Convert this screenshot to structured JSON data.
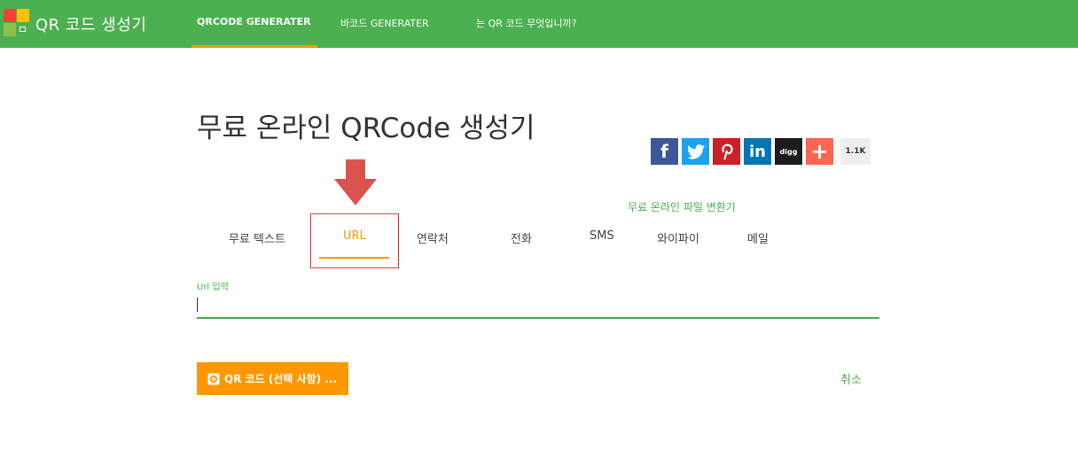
{
  "header": {
    "brand": "QR 코드 생성기",
    "nav": [
      {
        "label": "QRCODE GENERATER",
        "active": true
      },
      {
        "label": "바코드 GENERATER",
        "active": false
      },
      {
        "label": "는 QR 코드 무엇입니까?",
        "active": false
      }
    ],
    "logo_colors": [
      "#f44336",
      "#ffc107",
      "#8bc34a",
      "#ffffff"
    ]
  },
  "main": {
    "title": "무료 온라인 QRCode 생성기",
    "share": {
      "icons": [
        "facebook-icon",
        "twitter-icon",
        "pinterest-icon",
        "linkedin-icon",
        "digg-icon",
        "plus-icon"
      ],
      "digg_label": "digg",
      "count": "1.1K"
    },
    "file_converter_link": "무료 온라인 파일 변환기",
    "tabs": [
      {
        "label": "무료 텍스트"
      },
      {
        "label": "URL"
      },
      {
        "label": "연락처"
      },
      {
        "label": "전화"
      },
      {
        "label": "SMS"
      },
      {
        "label": "와이파이"
      },
      {
        "label": "메일"
      }
    ],
    "active_tab": "URL",
    "url_field": {
      "label": "Url 입력",
      "value": "",
      "placeholder": ""
    },
    "qr_button": "QR 코드 (선택 사항) ...",
    "cancel": "취소"
  },
  "colors": {
    "header_bg": "#4caf50",
    "accent": "#ff9800",
    "highlight": "#e53935",
    "arrow": "#d9534f"
  }
}
